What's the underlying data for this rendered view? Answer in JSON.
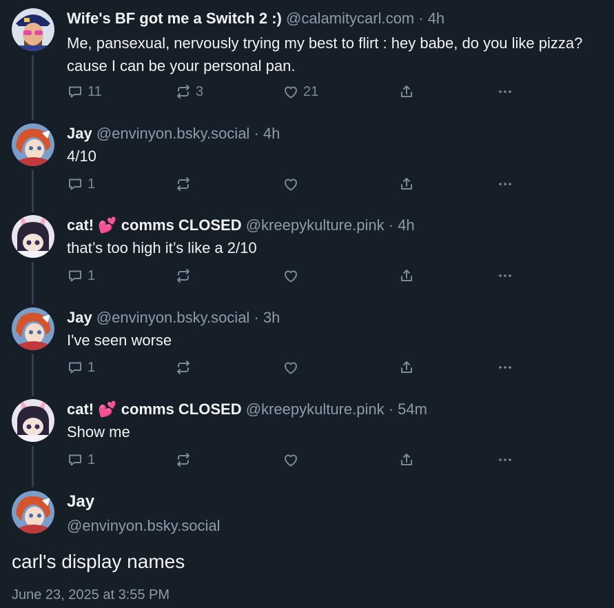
{
  "posts": [
    {
      "display_name": "Wife's BF got me a Switch 2 :)",
      "handle": "@calamitycarl.com",
      "time": "4h",
      "text": "Me, pansexual, nervously trying my best to flirt : hey babe, do you like pizza? cause I can be your personal pan.",
      "replies": "11",
      "reposts": "3",
      "likes": "21"
    },
    {
      "display_name": "Jay",
      "handle": "@envinyon.bsky.social",
      "time": "4h",
      "text": "4/10",
      "replies": "1",
      "reposts": "",
      "likes": ""
    },
    {
      "display_name_pre": "cat! ",
      "emoji": "💕",
      "display_name_post": " comms CLOSED",
      "handle": "@kreepykulture.pink",
      "time": "4h",
      "text": "that’s too high it’s like a 2/10",
      "replies": "1",
      "reposts": "",
      "likes": ""
    },
    {
      "display_name": "Jay",
      "handle": "@envinyon.bsky.social",
      "time": "3h",
      "text": "I've seen worse",
      "replies": "1",
      "reposts": "",
      "likes": ""
    },
    {
      "display_name_pre": "cat! ",
      "emoji": "💕",
      "display_name_post": " comms CLOSED",
      "handle": "@kreepykulture.pink",
      "time": "54m",
      "text": "Show me",
      "replies": "1",
      "reposts": "",
      "likes": ""
    }
  ],
  "main_post": {
    "display_name": "Jay",
    "handle": "@envinyon.bsky.social",
    "text": "carl's display names",
    "date": "June 23, 2025 at 3:55 PM"
  },
  "separator": " · ",
  "icons": [
    "reply-icon",
    "repost-icon",
    "like-icon",
    "share-icon",
    "more-icon"
  ],
  "colors": {
    "background": "#161e27",
    "text": "#f1f3f5",
    "muted": "#8d9bab",
    "icon": "#7b8a9a",
    "thread_line": "#2e4052"
  }
}
